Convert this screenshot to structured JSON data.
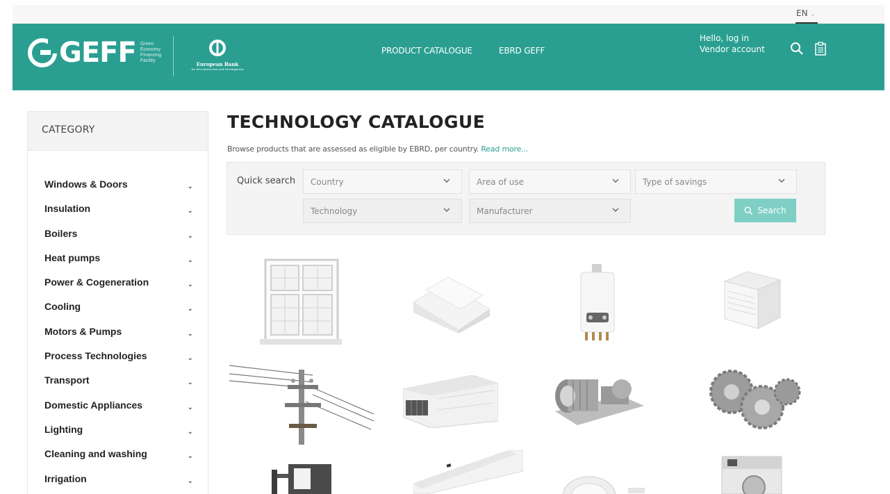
{
  "language": {
    "current": "EN"
  },
  "header": {
    "logo_text": "GEFF",
    "logo_tagline": [
      "Green",
      "Economy",
      "Financing",
      "Facility"
    ],
    "partner_name": "European Bank",
    "partner_sub": "for Reconstruction and Development",
    "nav": [
      {
        "label": "PRODUCT CATALOGUE"
      },
      {
        "label": "EBRD GEFF"
      }
    ],
    "account": {
      "greeting": "Hello, log in",
      "link": "Vendor account"
    },
    "icons": [
      "search-icon",
      "clipboard-icon"
    ]
  },
  "sidebar": {
    "heading": "CATEGORY",
    "items": [
      {
        "label": "Windows & Doors"
      },
      {
        "label": "Insulation"
      },
      {
        "label": "Boilers"
      },
      {
        "label": "Heat pumps"
      },
      {
        "label": "Power & Cogeneration"
      },
      {
        "label": "Cooling"
      },
      {
        "label": "Motors & Pumps"
      },
      {
        "label": "Process Technologies"
      },
      {
        "label": "Transport"
      },
      {
        "label": "Domestic Appliances"
      },
      {
        "label": "Lighting"
      },
      {
        "label": "Cleaning and washing"
      },
      {
        "label": "Irrigation"
      }
    ]
  },
  "main": {
    "title": "TECHNOLOGY CATALOGUE",
    "subtitle": "Browse products that are assessed as eligible by EBRD, per country.",
    "read_more": "Read more...",
    "quick_search": {
      "label": "Quick search",
      "country": "Country",
      "area": "Area of use",
      "savings": "Type of savings",
      "technology": "Technology",
      "manufacturer": "Manufacturer",
      "button": "Search"
    },
    "tiles": [
      "window",
      "insulation-boards",
      "boiler",
      "heat-pump",
      "power-pole",
      "cooling-unit",
      "motor-pump",
      "gears",
      "forklift",
      "air-conditioner",
      "meter",
      "washing-machine"
    ]
  },
  "colors": {
    "brand": "#2a9f91",
    "button": "#7fcfc5"
  }
}
